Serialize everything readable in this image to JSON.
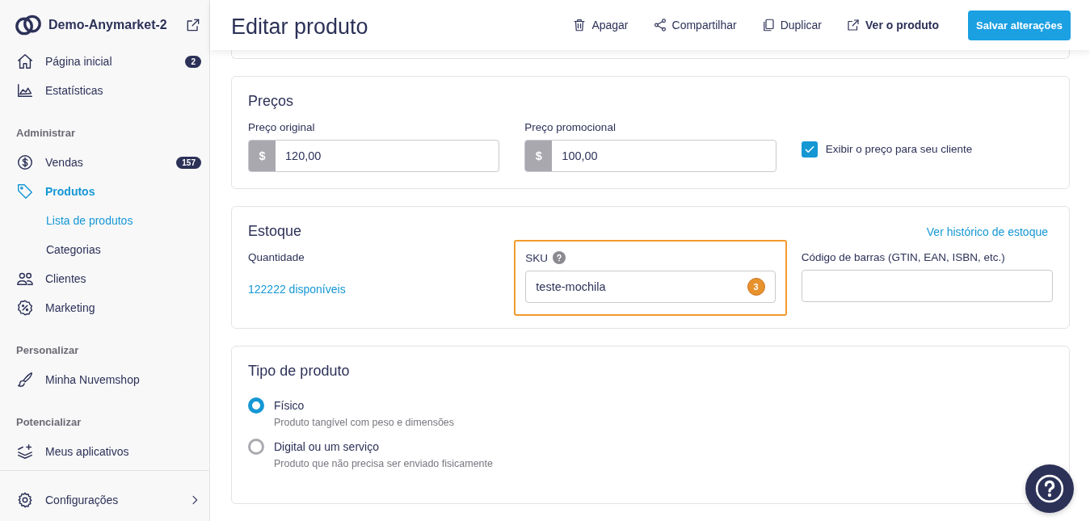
{
  "store": {
    "name": "Demo-Anymarket-2"
  },
  "sidebar": {
    "items": [
      {
        "kind": "item",
        "label": "Página inicial",
        "badge": "2",
        "selected": false
      },
      {
        "kind": "item",
        "label": "Estatísticas",
        "selected": false
      },
      {
        "kind": "section",
        "label": "Administrar"
      },
      {
        "kind": "item",
        "label": "Vendas",
        "badge": "157",
        "selected": false
      },
      {
        "kind": "item",
        "label": "Produtos",
        "selected": true
      },
      {
        "kind": "subitem",
        "label": "Lista de produtos",
        "selected": true
      },
      {
        "kind": "subitem",
        "label": "Categorias",
        "selected": false
      },
      {
        "kind": "item",
        "label": "Clientes",
        "selected": false
      },
      {
        "kind": "item",
        "label": "Marketing",
        "selected": false
      },
      {
        "kind": "section",
        "label": "Personalizar"
      },
      {
        "kind": "item",
        "label": "Minha Nuvemshop",
        "selected": false
      },
      {
        "kind": "section",
        "label": "Potencializar"
      },
      {
        "kind": "item",
        "label": "Meus aplicativos",
        "selected": false
      }
    ],
    "footer": {
      "label": "Configurações"
    }
  },
  "header": {
    "title": "Editar produto",
    "actions": [
      {
        "label": "Apagar",
        "kind": "plain"
      },
      {
        "label": "Compartilhar",
        "kind": "plain"
      },
      {
        "label": "Duplicar",
        "kind": "plain"
      },
      {
        "label": "Ver o produto",
        "kind": "bold"
      },
      {
        "label": "Salvar alterações",
        "kind": "primary"
      }
    ]
  },
  "prices": {
    "title": "Preços",
    "fields": [
      {
        "label": "Preço original",
        "prefix": "$",
        "value": "120,00"
      },
      {
        "label": "Preço promocional",
        "prefix": "$",
        "value": "100,00"
      }
    ],
    "checkbox": {
      "label": "Exibir o preço para seu cliente",
      "checked": true
    }
  },
  "stock": {
    "title": "Estoque",
    "link": "Ver histórico de estoque",
    "quantity_label": "Quantidade",
    "quantity": "122222 disponíveis",
    "sku": {
      "label": "SKU",
      "value": "teste-mochila",
      "badge": "3",
      "highlighted": true
    },
    "barcode": {
      "label": "Código de barras (GTIN, EAN, ISBN, etc.)"
    }
  },
  "product_type": {
    "title": "Tipo de produto",
    "options": [
      {
        "label": "Físico",
        "description": "Produto tangível com peso e dimensões",
        "selected": true
      },
      {
        "label": "Digital ou um serviço",
        "description": "Produto que não precisa ser enviado fisicamente",
        "selected": false
      }
    ]
  }
}
